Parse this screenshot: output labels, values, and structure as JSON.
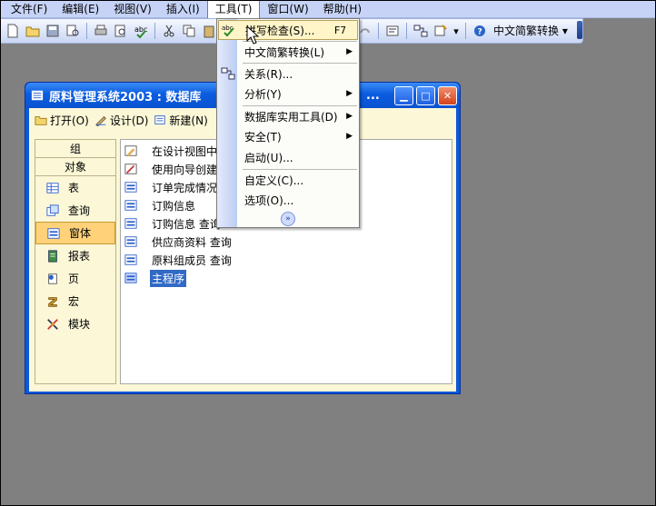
{
  "menubar": {
    "items": [
      {
        "label": "文件(F)"
      },
      {
        "label": "编辑(E)"
      },
      {
        "label": "视图(V)"
      },
      {
        "label": "插入(I)"
      },
      {
        "label": "工具(T)"
      },
      {
        "label": "窗口(W)"
      },
      {
        "label": "帮助(H)"
      }
    ]
  },
  "toolbar": {
    "convert_label": "中文简繁转换"
  },
  "dbwindow": {
    "title": "原料管理系统2003 : 数据库",
    "title_overflow": "...",
    "toolbar": {
      "open": "打开(O)",
      "design": "设计(D)",
      "new": "新建(N)"
    },
    "group_header": "组",
    "objects_header": "对象",
    "groups": [
      {
        "label": "表",
        "icon": "table-icon"
      },
      {
        "label": "查询",
        "icon": "query-icon"
      },
      {
        "label": "窗体",
        "icon": "form-icon"
      },
      {
        "label": "报表",
        "icon": "report-icon"
      },
      {
        "label": "页",
        "icon": "page-icon"
      },
      {
        "label": "宏",
        "icon": "macro-icon"
      },
      {
        "label": "模块",
        "icon": "module-icon"
      }
    ],
    "objects": [
      {
        "label": "在设计视图中"
      },
      {
        "label": "使用向导创建"
      },
      {
        "label": "订单完成情况"
      },
      {
        "label": "订购信息"
      },
      {
        "label": "订购信息 查询"
      },
      {
        "label": "供应商资料 查询"
      },
      {
        "label": "原料组成员 查询"
      },
      {
        "label": "主程序"
      }
    ]
  },
  "tools_menu": {
    "items": [
      {
        "label": "拼写检查(S)...",
        "shortcut": "F7"
      },
      {
        "label": "中文简繁转换(L)"
      },
      {
        "label": "关系(R)..."
      },
      {
        "label": "分析(Y)"
      },
      {
        "label": "数据库实用工具(D)"
      },
      {
        "label": "安全(T)"
      },
      {
        "label": "启动(U)..."
      },
      {
        "label": "自定义(C)..."
      },
      {
        "label": "选项(O)..."
      }
    ]
  },
  "colors": {
    "desktop": "#808080",
    "menubar": "#c6d3f7",
    "title_bar": "#0a5ce0",
    "selection": "#316ac5",
    "menu_highlight": "#fff5c9"
  }
}
